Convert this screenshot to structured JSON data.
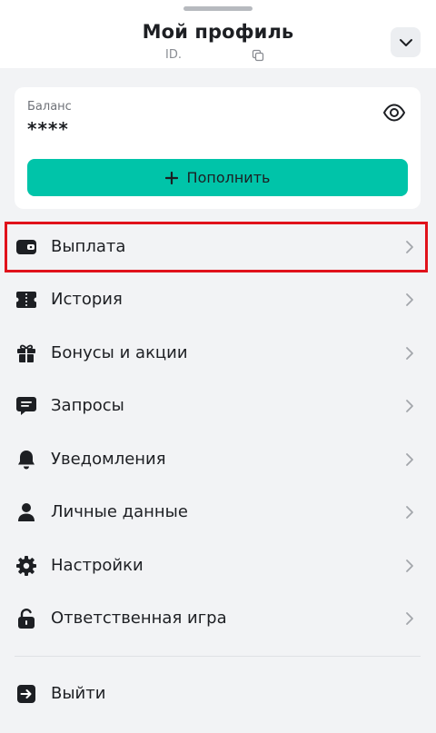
{
  "header": {
    "title": "Мой профиль",
    "id_label": "ID."
  },
  "balance": {
    "label": "Баланс",
    "value": "****",
    "topup_label": "Пополнить"
  },
  "menu": {
    "items": [
      {
        "label": "Выплата",
        "icon": "wallet-icon"
      },
      {
        "label": "История",
        "icon": "ticket-icon"
      },
      {
        "label": "Бонусы и акции",
        "icon": "gift-icon"
      },
      {
        "label": "Запросы",
        "icon": "chat-icon"
      },
      {
        "label": "Уведомления",
        "icon": "bell-icon"
      },
      {
        "label": "Личные данные",
        "icon": "user-icon"
      },
      {
        "label": "Настройки",
        "icon": "gear-icon"
      },
      {
        "label": "Ответственная игра",
        "icon": "lock-open-icon"
      }
    ],
    "logout_label": "Выйти"
  },
  "colors": {
    "accent": "#00c4a9",
    "highlight": "#e0121b",
    "background": "#f2f3f5"
  }
}
